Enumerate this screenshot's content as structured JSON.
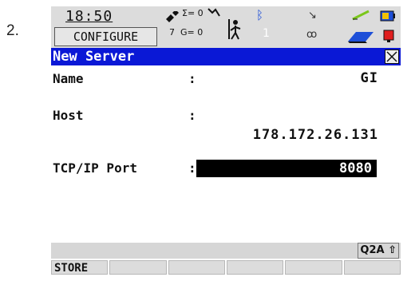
{
  "step_number": "2.",
  "status": {
    "time": "18:50",
    "mode": "CONFIGURE",
    "sat_count_sigma": "Σ= 0",
    "sat_count_7": "7",
    "sat_count_g": "G= 0",
    "line_one": "1"
  },
  "window": {
    "title": "New Server"
  },
  "fields": [
    {
      "label": "Name",
      "colon": ":",
      "value": "GI"
    },
    {
      "label": "Host",
      "colon": ":",
      "value": "178.172.26.131"
    },
    {
      "label": "TCP/IP Port",
      "colon": ":",
      "value": "8080"
    }
  ],
  "keyboard_indicator": "Q2A ⇧",
  "function_keys": [
    "STORE",
    "",
    "",
    "",
    "",
    ""
  ],
  "colors": {
    "title_bar": "#0a18d6",
    "status_bar": "#dcdcdc",
    "selected_input": "#000000"
  }
}
